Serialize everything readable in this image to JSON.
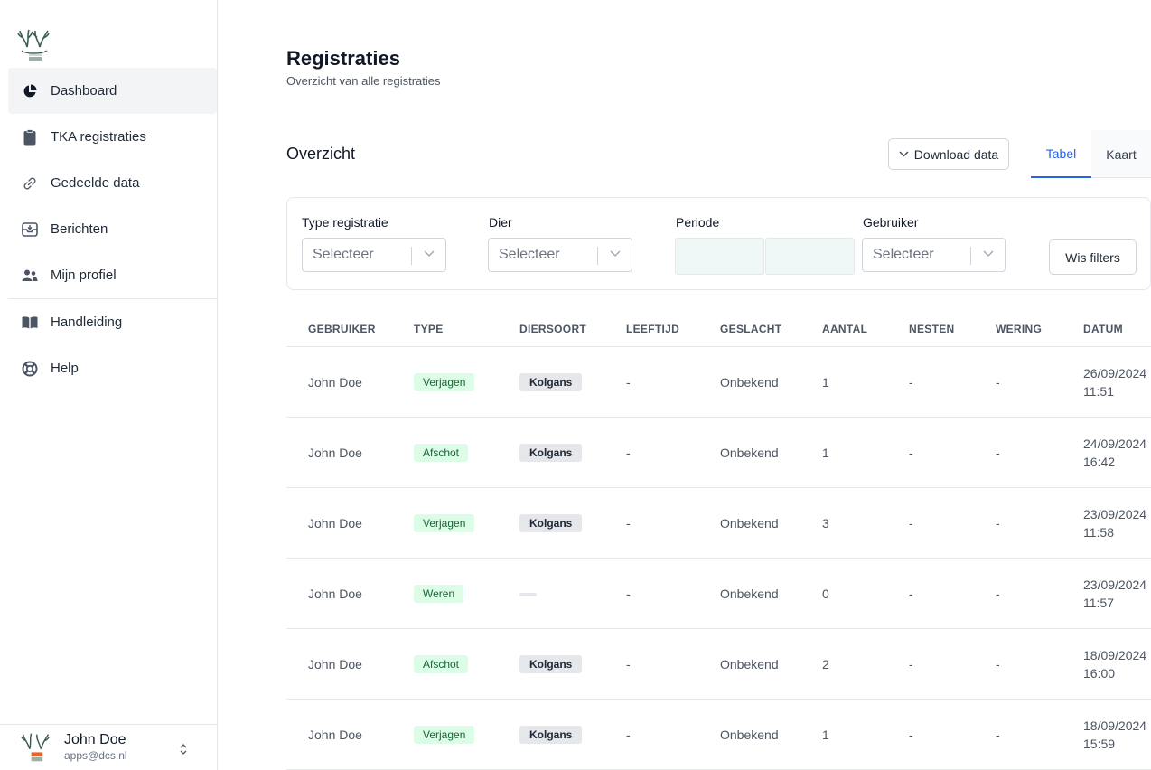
{
  "sidebar": {
    "items": [
      {
        "label": "Dashboard",
        "icon": "pie-chart-icon",
        "active": true
      },
      {
        "label": "TKA registraties",
        "icon": "clipboard-icon",
        "active": false
      },
      {
        "label": "Gedeelde data",
        "icon": "link-icon",
        "active": false
      },
      {
        "label": "Berichten",
        "icon": "inbox-icon",
        "active": false
      },
      {
        "label": "Mijn profiel",
        "icon": "users-icon",
        "active": false
      },
      {
        "label": "Handleiding",
        "icon": "book-icon",
        "active": false
      },
      {
        "label": "Help",
        "icon": "lifebuoy-icon",
        "active": false
      }
    ],
    "user": {
      "name": "John Doe",
      "email": "apps@dcs.nl"
    }
  },
  "header": {
    "title": "Registraties",
    "subtitle": "Overzicht van alle registraties"
  },
  "overview": {
    "title": "Overzicht",
    "download_label": "Download data",
    "tabs": [
      {
        "label": "Tabel",
        "active": true
      },
      {
        "label": "Kaart",
        "active": false
      }
    ]
  },
  "filters": {
    "type_label": "Type registratie",
    "type_placeholder": "Selecteer",
    "dier_label": "Dier",
    "dier_placeholder": "Selecteer",
    "periode_label": "Periode",
    "gebruiker_label": "Gebruiker",
    "gebruiker_placeholder": "Selecteer",
    "clear_label": "Wis filters"
  },
  "table": {
    "columns": [
      "GEBRUIKER",
      "TYPE",
      "DIERSOORT",
      "LEEFTIJD",
      "GESLACHT",
      "AANTAL",
      "NESTEN",
      "WERING",
      "DATUM"
    ],
    "rows": [
      {
        "gebruiker": "John Doe",
        "type": "Verjagen",
        "diersoort": "Kolgans",
        "leeftijd": "-",
        "geslacht": "Onbekend",
        "aantal": "1",
        "nesten": "-",
        "wering": "-",
        "date": "26/09/2024",
        "time": "11:51"
      },
      {
        "gebruiker": "John Doe",
        "type": "Afschot",
        "diersoort": "Kolgans",
        "leeftijd": "-",
        "geslacht": "Onbekend",
        "aantal": "1",
        "nesten": "-",
        "wering": "-",
        "date": "24/09/2024",
        "time": "16:42"
      },
      {
        "gebruiker": "John Doe",
        "type": "Verjagen",
        "diersoort": "Kolgans",
        "leeftijd": "-",
        "geslacht": "Onbekend",
        "aantal": "3",
        "nesten": "-",
        "wering": "-",
        "date": "23/09/2024",
        "time": "11:58"
      },
      {
        "gebruiker": "John Doe",
        "type": "Weren",
        "diersoort": "",
        "leeftijd": "-",
        "geslacht": "Onbekend",
        "aantal": "0",
        "nesten": "-",
        "wering": "-",
        "date": "23/09/2024",
        "time": "11:57"
      },
      {
        "gebruiker": "John Doe",
        "type": "Afschot",
        "diersoort": "Kolgans",
        "leeftijd": "-",
        "geslacht": "Onbekend",
        "aantal": "2",
        "nesten": "-",
        "wering": "-",
        "date": "18/09/2024",
        "time": "16:00"
      },
      {
        "gebruiker": "John Doe",
        "type": "Verjagen",
        "diersoort": "Kolgans",
        "leeftijd": "-",
        "geslacht": "Onbekend",
        "aantal": "1",
        "nesten": "-",
        "wering": "-",
        "date": "18/09/2024",
        "time": "15:59"
      }
    ]
  },
  "colors": {
    "accent": "#2563eb",
    "badge_green_bg": "#dcfce7",
    "badge_green_text": "#166534",
    "badge_gray_bg": "#e5e7eb"
  }
}
